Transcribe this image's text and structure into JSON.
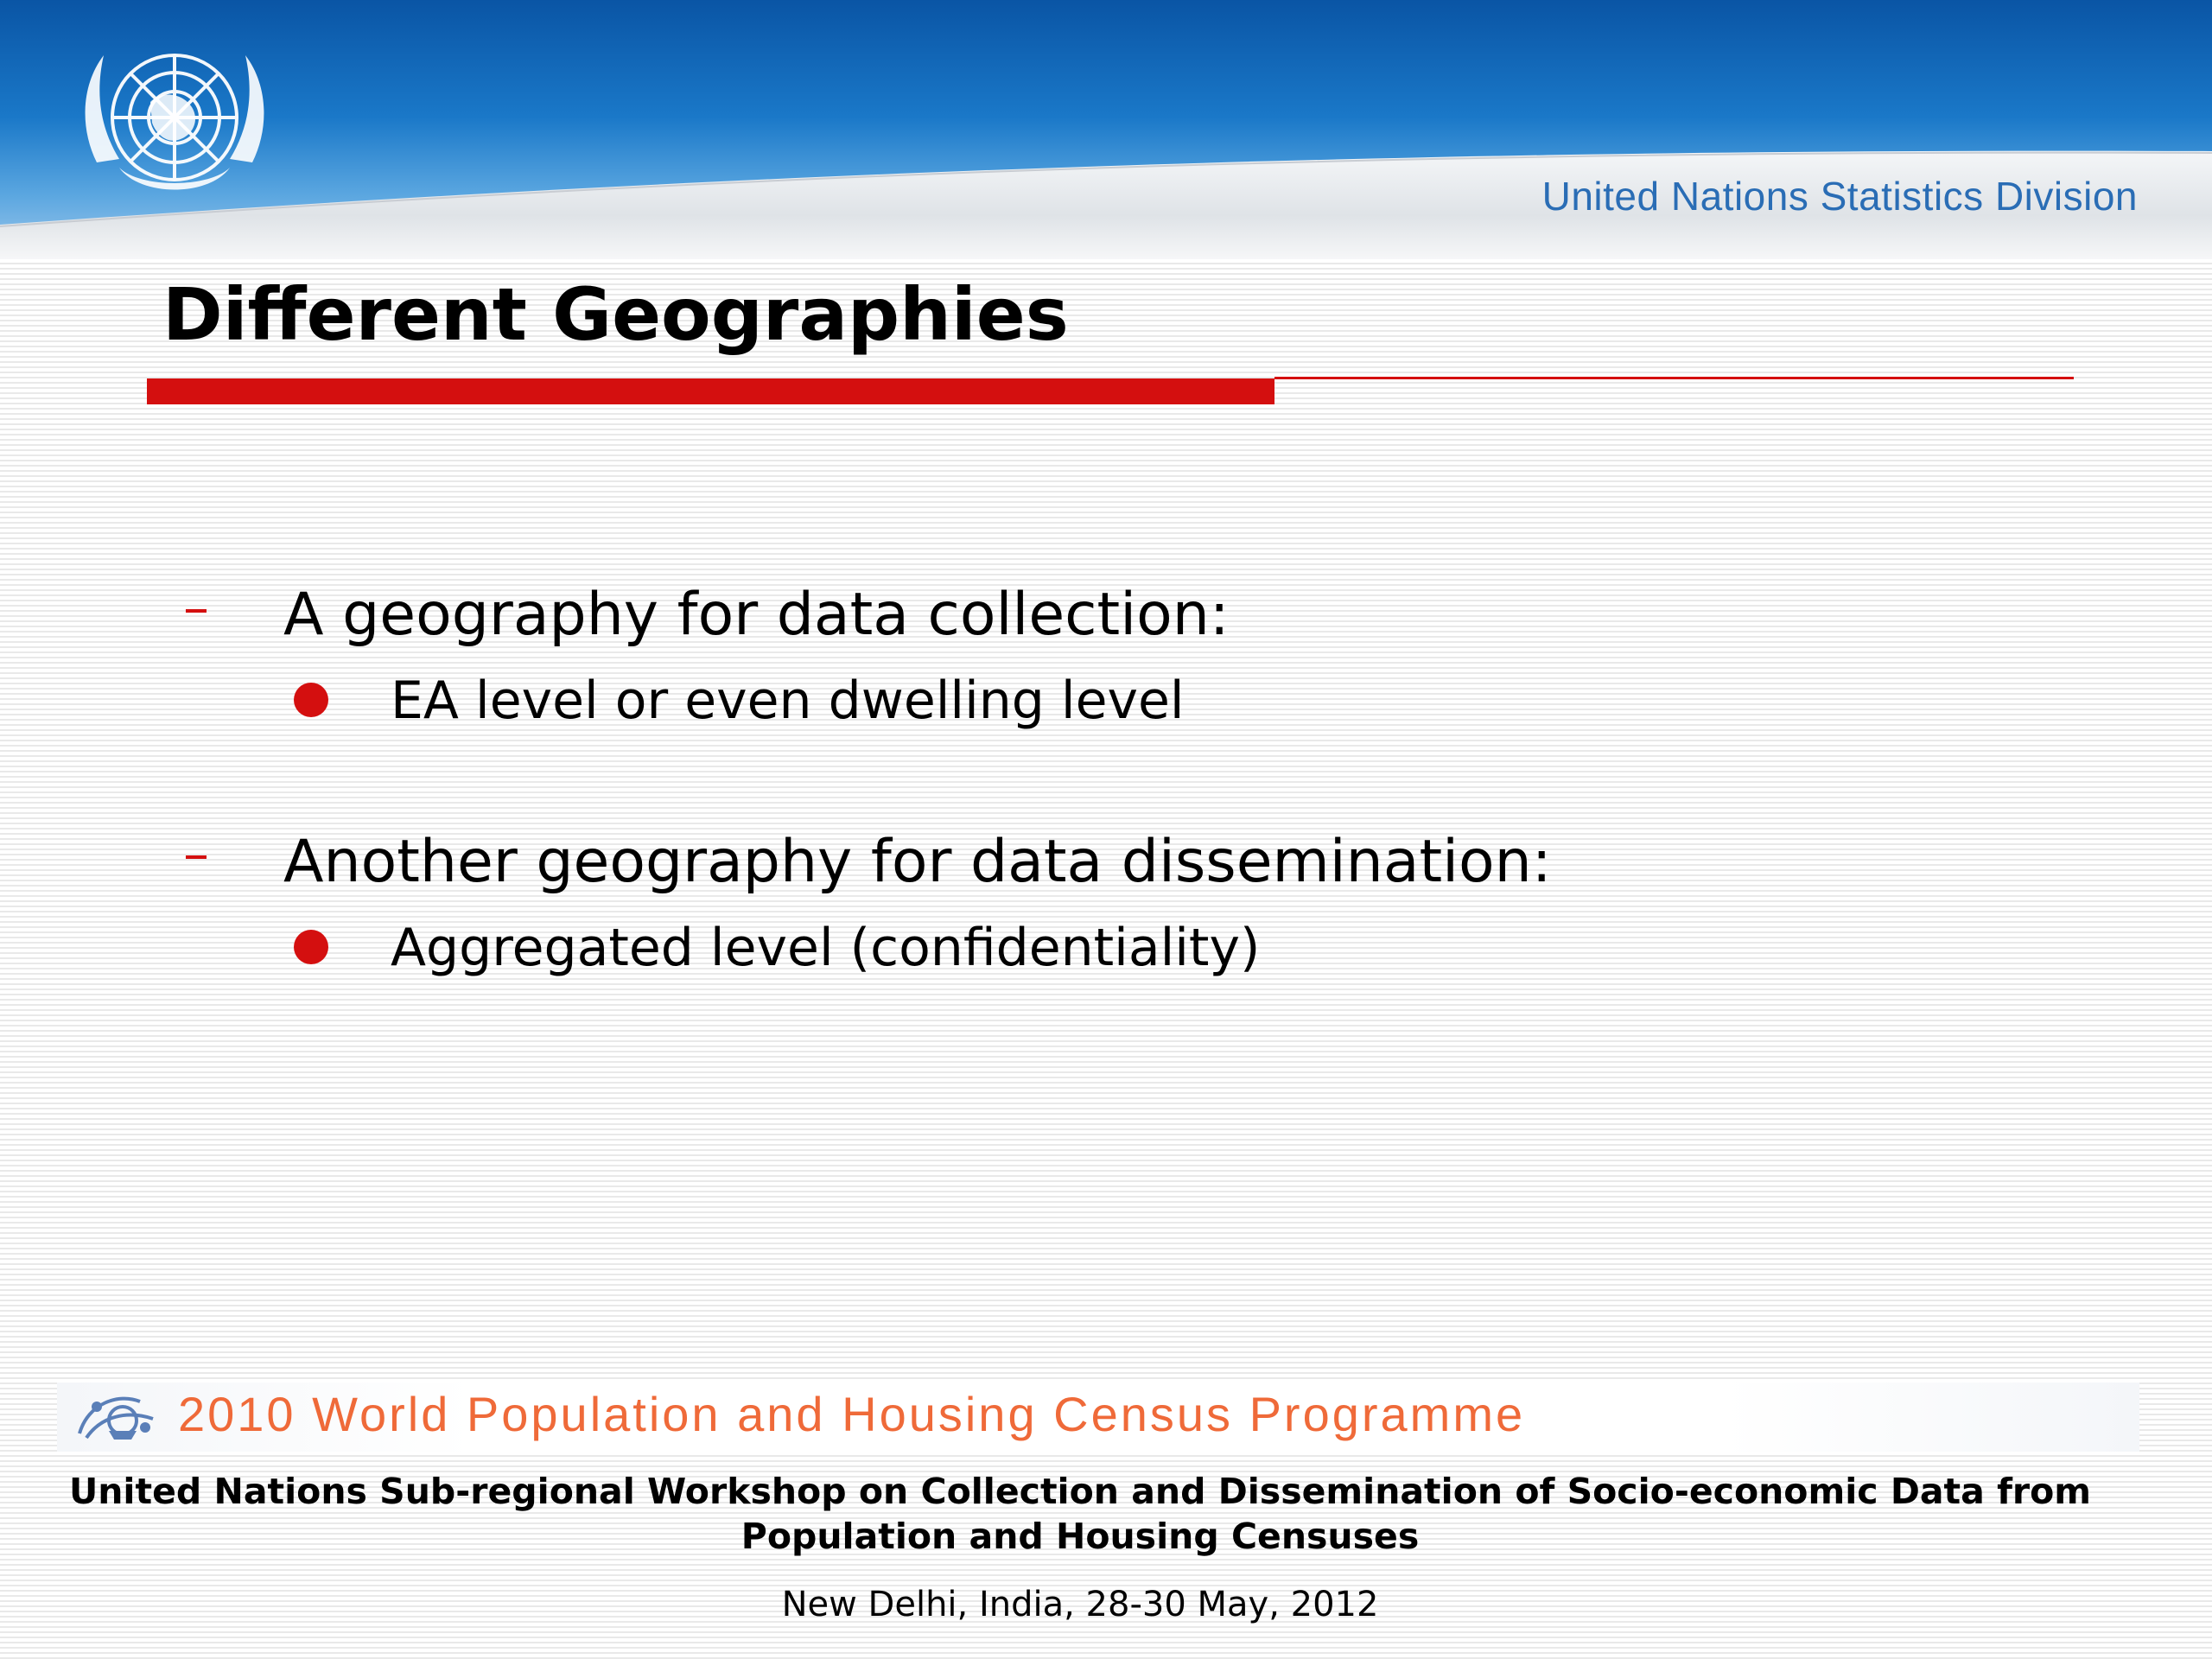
{
  "header": {
    "organization": "United Nations Statistics Division"
  },
  "slide": {
    "title": "Different Geographies",
    "bullets": [
      {
        "text": "A geography for data collection:",
        "sub": [
          "EA level or even dwelling level"
        ]
      },
      {
        "text": "Another geography for data dissemination:",
        "sub": [
          "Aggregated level (confidentiality)"
        ]
      }
    ]
  },
  "footer": {
    "programme": "2010 World Population and Housing Census Programme",
    "workshop": "United Nations Sub-regional Workshop on Collection and Dissemination of Socio-economic Data from Population and Housing Censuses",
    "venue_date": "New Delhi, India, 28-30 May, 2012"
  },
  "colors": {
    "accent_red": "#d40f0f",
    "header_blue": "#1a78c8",
    "org_text_blue": "#2a6db5",
    "programme_orange": "#ef6a39"
  },
  "icons": {
    "emblem": "un-emblem-icon",
    "census_logo": "census-programme-logo-icon",
    "level1_marker": "dash-bullet-icon",
    "level2_marker": "red-dot-bullet-icon"
  }
}
